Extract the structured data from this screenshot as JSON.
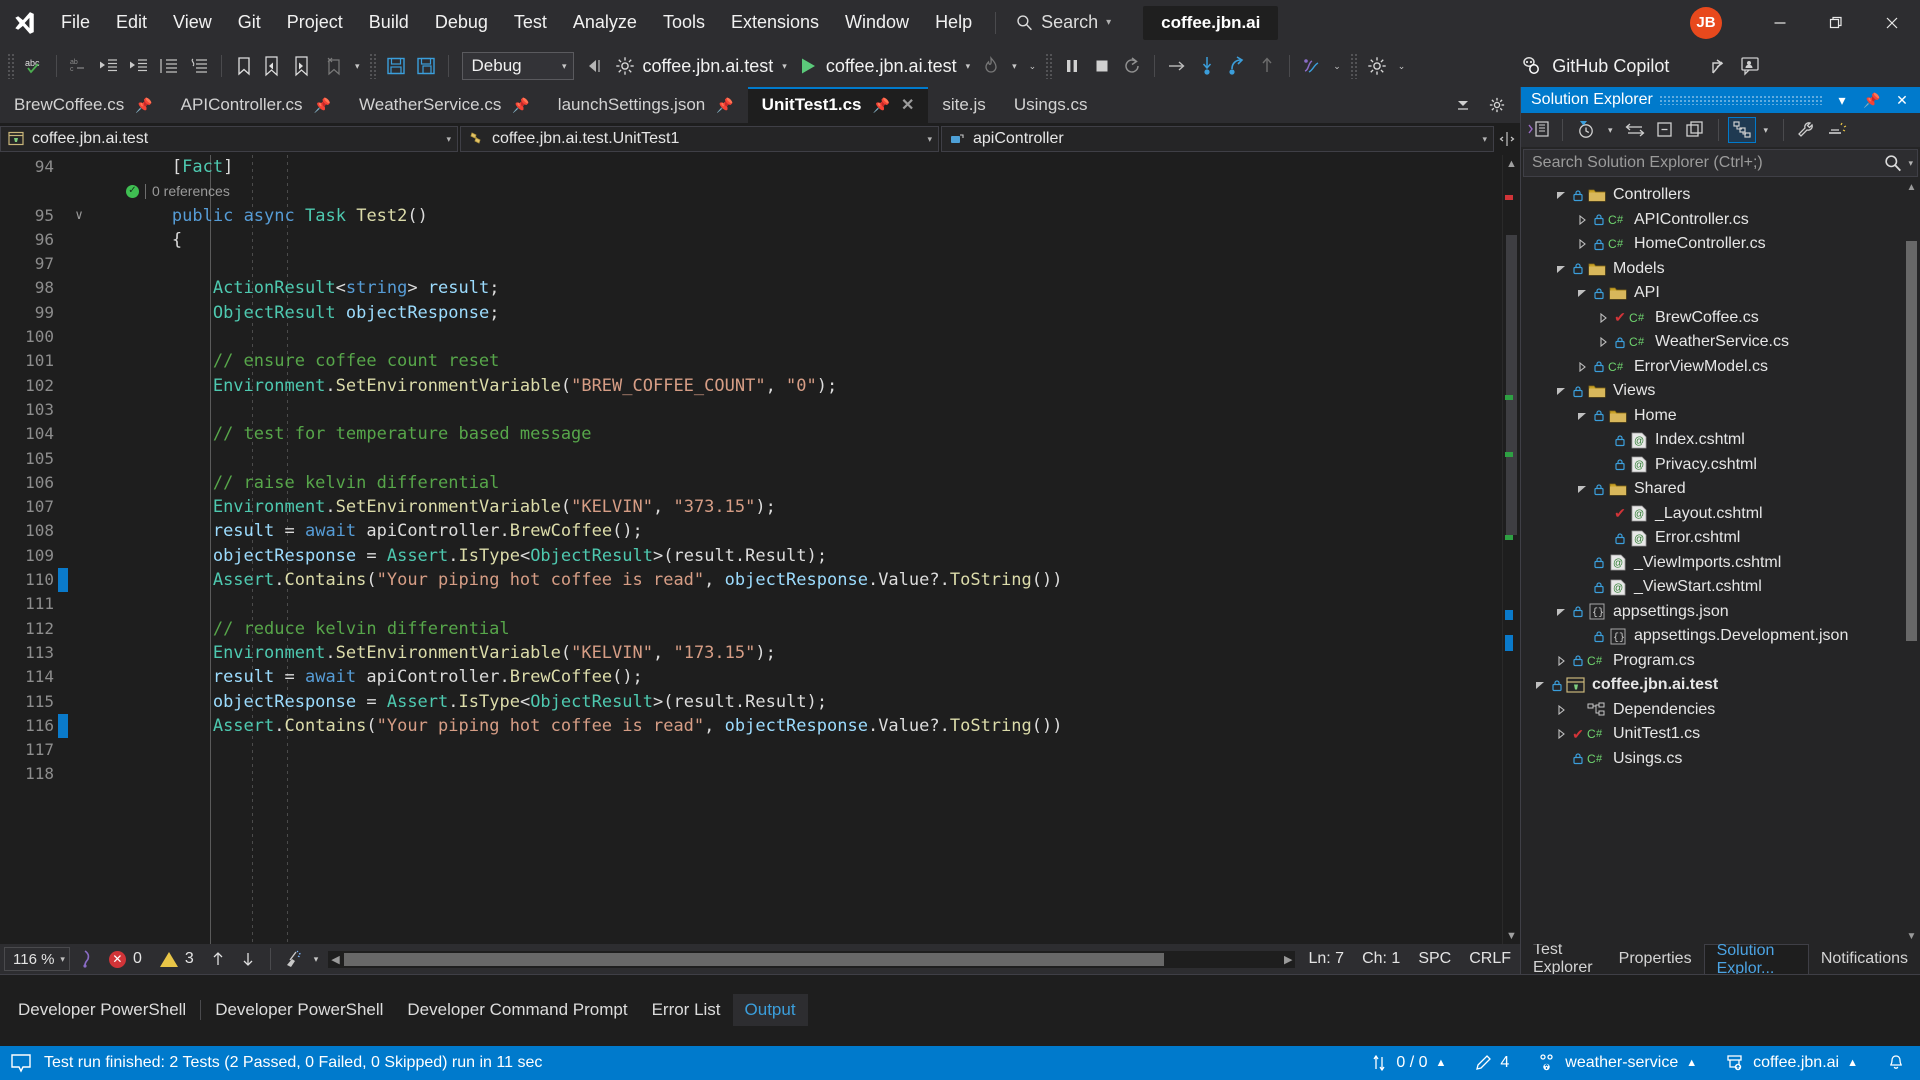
{
  "titlebar": {
    "logo_icon": "visual-studio-logo",
    "menus": [
      "File",
      "Edit",
      "View",
      "Git",
      "Project",
      "Build",
      "Debug",
      "Test",
      "Analyze",
      "Tools",
      "Extensions",
      "Window",
      "Help"
    ],
    "search": {
      "label": "Search",
      "icon": "search-icon",
      "caret": "▾"
    },
    "solution_name": "coffee.jbn.ai",
    "avatar_initials": "JB",
    "avatar_color": "#e8491d",
    "window_buttons": {
      "minimize": "minimize-icon",
      "restore": "restore-icon",
      "close": "close-icon"
    }
  },
  "toolbar": {
    "config_value": "Debug",
    "startup_project": "coffee.jbn.ai.test",
    "run_target": "coffee.jbn.ai.test",
    "copilot_label": "GitHub Copilot",
    "caret": "▾"
  },
  "tabs": [
    {
      "label": "BrewCoffee.cs",
      "pinned": true,
      "active": false
    },
    {
      "label": "APIController.cs",
      "pinned": true,
      "active": false
    },
    {
      "label": "WeatherService.cs",
      "pinned": true,
      "active": false
    },
    {
      "label": "launchSettings.json",
      "pinned": true,
      "active": false
    },
    {
      "label": "UnitTest1.cs",
      "pinned": true,
      "active": true,
      "closable": true
    },
    {
      "label": "site.js",
      "pinned": false,
      "active": false
    },
    {
      "label": "Usings.cs",
      "pinned": false,
      "active": false
    }
  ],
  "navbar": {
    "project": "coffee.jbn.ai.test",
    "type": "coffee.jbn.ai.test.UnitTest1",
    "member": "apiController",
    "caret": "▾"
  },
  "code": {
    "codelens": "0 references",
    "first_line_number": 94,
    "lines": [
      {
        "n": 94,
        "fold": "",
        "change": "",
        "tokens": [
          {
            "t": "        ",
            "c": "pln"
          },
          {
            "t": "[",
            "c": "pln"
          },
          {
            "t": "Fact",
            "c": "attr"
          },
          {
            "t": "]",
            "c": "pln"
          }
        ]
      },
      {
        "n": "",
        "fold": "",
        "change": "",
        "codelens": true
      },
      {
        "n": 95,
        "fold": "∨",
        "change": "",
        "tokens": [
          {
            "t": "        ",
            "c": "pln"
          },
          {
            "t": "public",
            "c": "kw"
          },
          {
            "t": " ",
            "c": "pln"
          },
          {
            "t": "async",
            "c": "kw"
          },
          {
            "t": " ",
            "c": "pln"
          },
          {
            "t": "Task",
            "c": "typ"
          },
          {
            "t": " ",
            "c": "pln"
          },
          {
            "t": "Test2",
            "c": "mth"
          },
          {
            "t": "()",
            "c": "pln"
          }
        ]
      },
      {
        "n": 96,
        "fold": "",
        "change": "",
        "tokens": [
          {
            "t": "        {",
            "c": "pln"
          }
        ]
      },
      {
        "n": 97,
        "fold": "",
        "change": "",
        "tokens": []
      },
      {
        "n": 98,
        "fold": "",
        "change": "",
        "tokens": [
          {
            "t": "            ",
            "c": "pln"
          },
          {
            "t": "ActionResult",
            "c": "typ"
          },
          {
            "t": "<",
            "c": "pln"
          },
          {
            "t": "string",
            "c": "kw"
          },
          {
            "t": "> ",
            "c": "pln"
          },
          {
            "t": "result",
            "c": "var"
          },
          {
            "t": ";",
            "c": "pln"
          }
        ]
      },
      {
        "n": 99,
        "fold": "",
        "change": "",
        "tokens": [
          {
            "t": "            ",
            "c": "pln"
          },
          {
            "t": "ObjectResult",
            "c": "typ"
          },
          {
            "t": " ",
            "c": "pln"
          },
          {
            "t": "objectResponse",
            "c": "var"
          },
          {
            "t": ";",
            "c": "pln"
          }
        ]
      },
      {
        "n": 100,
        "fold": "",
        "change": "",
        "tokens": []
      },
      {
        "n": 101,
        "fold": "",
        "change": "",
        "tokens": [
          {
            "t": "            ",
            "c": "pln"
          },
          {
            "t": "// ensure coffee count reset",
            "c": "com"
          }
        ]
      },
      {
        "n": 102,
        "fold": "",
        "change": "",
        "tokens": [
          {
            "t": "            ",
            "c": "pln"
          },
          {
            "t": "Environment",
            "c": "typ"
          },
          {
            "t": ".",
            "c": "pln"
          },
          {
            "t": "SetEnvironmentVariable",
            "c": "mth"
          },
          {
            "t": "(",
            "c": "pln"
          },
          {
            "t": "\"BREW_COFFEE_COUNT\"",
            "c": "str"
          },
          {
            "t": ", ",
            "c": "pln"
          },
          {
            "t": "\"0\"",
            "c": "str"
          },
          {
            "t": ");",
            "c": "pln"
          }
        ]
      },
      {
        "n": 103,
        "fold": "",
        "change": "",
        "tokens": []
      },
      {
        "n": 104,
        "fold": "",
        "change": "",
        "tokens": [
          {
            "t": "            ",
            "c": "pln"
          },
          {
            "t": "// test for temperature based message",
            "c": "com"
          }
        ]
      },
      {
        "n": 105,
        "fold": "",
        "change": "",
        "tokens": []
      },
      {
        "n": 106,
        "fold": "",
        "change": "",
        "tokens": [
          {
            "t": "            ",
            "c": "pln"
          },
          {
            "t": "// raise kelvin differential",
            "c": "com"
          }
        ]
      },
      {
        "n": 107,
        "fold": "",
        "change": "",
        "tokens": [
          {
            "t": "            ",
            "c": "pln"
          },
          {
            "t": "Environment",
            "c": "typ"
          },
          {
            "t": ".",
            "c": "pln"
          },
          {
            "t": "SetEnvironmentVariable",
            "c": "mth"
          },
          {
            "t": "(",
            "c": "pln"
          },
          {
            "t": "\"KELVIN\"",
            "c": "str"
          },
          {
            "t": ", ",
            "c": "pln"
          },
          {
            "t": "\"373.15\"",
            "c": "str"
          },
          {
            "t": ");",
            "c": "pln"
          }
        ]
      },
      {
        "n": 108,
        "fold": "",
        "change": "",
        "tokens": [
          {
            "t": "            ",
            "c": "pln"
          },
          {
            "t": "result",
            "c": "var"
          },
          {
            "t": " = ",
            "c": "pln"
          },
          {
            "t": "await",
            "c": "kw"
          },
          {
            "t": " ",
            "c": "pln"
          },
          {
            "t": "apiController",
            "c": "pln"
          },
          {
            "t": ".",
            "c": "pln"
          },
          {
            "t": "BrewCoffee",
            "c": "mth"
          },
          {
            "t": "();",
            "c": "pln"
          }
        ]
      },
      {
        "n": 109,
        "fold": "",
        "change": "",
        "tokens": [
          {
            "t": "            ",
            "c": "pln"
          },
          {
            "t": "objectResponse",
            "c": "var"
          },
          {
            "t": " = ",
            "c": "pln"
          },
          {
            "t": "Assert",
            "c": "typ"
          },
          {
            "t": ".",
            "c": "pln"
          },
          {
            "t": "IsType",
            "c": "mth"
          },
          {
            "t": "<",
            "c": "pln"
          },
          {
            "t": "ObjectResult",
            "c": "typ"
          },
          {
            "t": ">(",
            "c": "pln"
          },
          {
            "t": "result",
            "c": "pln"
          },
          {
            "t": ".",
            "c": "pln"
          },
          {
            "t": "Result",
            "c": "pln"
          },
          {
            "t": ");",
            "c": "pln"
          }
        ]
      },
      {
        "n": 110,
        "fold": "",
        "change": "mod",
        "tokens": [
          {
            "t": "            ",
            "c": "pln"
          },
          {
            "t": "Assert",
            "c": "typ"
          },
          {
            "t": ".",
            "c": "pln"
          },
          {
            "t": "Contains",
            "c": "mth"
          },
          {
            "t": "(",
            "c": "pln"
          },
          {
            "t": "\"Your piping hot coffee is read\"",
            "c": "str"
          },
          {
            "t": ", ",
            "c": "pln"
          },
          {
            "t": "objectResponse",
            "c": "var"
          },
          {
            "t": ".",
            "c": "pln"
          },
          {
            "t": "Value",
            "c": "pln"
          },
          {
            "t": "?.",
            "c": "pln"
          },
          {
            "t": "ToString",
            "c": "mth"
          },
          {
            "t": "())",
            "c": "pln"
          }
        ]
      },
      {
        "n": 111,
        "fold": "",
        "change": "",
        "tokens": []
      },
      {
        "n": 112,
        "fold": "",
        "change": "",
        "tokens": [
          {
            "t": "            ",
            "c": "pln"
          },
          {
            "t": "// reduce kelvin differential",
            "c": "com"
          }
        ]
      },
      {
        "n": 113,
        "fold": "",
        "change": "",
        "tokens": [
          {
            "t": "            ",
            "c": "pln"
          },
          {
            "t": "Environment",
            "c": "typ"
          },
          {
            "t": ".",
            "c": "pln"
          },
          {
            "t": "SetEnvironmentVariable",
            "c": "mth"
          },
          {
            "t": "(",
            "c": "pln"
          },
          {
            "t": "\"KELVIN\"",
            "c": "str"
          },
          {
            "t": ", ",
            "c": "pln"
          },
          {
            "t": "\"173.15\"",
            "c": "str"
          },
          {
            "t": ");",
            "c": "pln"
          }
        ]
      },
      {
        "n": 114,
        "fold": "",
        "change": "",
        "tokens": [
          {
            "t": "            ",
            "c": "pln"
          },
          {
            "t": "result",
            "c": "var"
          },
          {
            "t": " = ",
            "c": "pln"
          },
          {
            "t": "await",
            "c": "kw"
          },
          {
            "t": " ",
            "c": "pln"
          },
          {
            "t": "apiController",
            "c": "pln"
          },
          {
            "t": ".",
            "c": "pln"
          },
          {
            "t": "BrewCoffee",
            "c": "mth"
          },
          {
            "t": "();",
            "c": "pln"
          }
        ]
      },
      {
        "n": 115,
        "fold": "",
        "change": "",
        "tokens": [
          {
            "t": "            ",
            "c": "pln"
          },
          {
            "t": "objectResponse",
            "c": "var"
          },
          {
            "t": " = ",
            "c": "pln"
          },
          {
            "t": "Assert",
            "c": "typ"
          },
          {
            "t": ".",
            "c": "pln"
          },
          {
            "t": "IsType",
            "c": "mth"
          },
          {
            "t": "<",
            "c": "pln"
          },
          {
            "t": "ObjectResult",
            "c": "typ"
          },
          {
            "t": ">(",
            "c": "pln"
          },
          {
            "t": "result",
            "c": "pln"
          },
          {
            "t": ".",
            "c": "pln"
          },
          {
            "t": "Result",
            "c": "pln"
          },
          {
            "t": ");",
            "c": "pln"
          }
        ]
      },
      {
        "n": 116,
        "fold": "",
        "change": "mod",
        "tokens": [
          {
            "t": "            ",
            "c": "pln"
          },
          {
            "t": "Assert",
            "c": "typ"
          },
          {
            "t": ".",
            "c": "pln"
          },
          {
            "t": "Contains",
            "c": "mth"
          },
          {
            "t": "(",
            "c": "pln"
          },
          {
            "t": "\"Your piping hot coffee is read\"",
            "c": "str"
          },
          {
            "t": ", ",
            "c": "pln"
          },
          {
            "t": "objectResponse",
            "c": "var"
          },
          {
            "t": ".",
            "c": "pln"
          },
          {
            "t": "Value",
            "c": "pln"
          },
          {
            "t": "?.",
            "c": "pln"
          },
          {
            "t": "ToString",
            "c": "mth"
          },
          {
            "t": "())",
            "c": "pln"
          }
        ]
      },
      {
        "n": 117,
        "fold": "",
        "change": "",
        "tokens": []
      },
      {
        "n": 118,
        "fold": "",
        "change": "",
        "tokens": []
      }
    ]
  },
  "editor_status": {
    "zoom": "116 %",
    "errors": "0",
    "warnings": "3",
    "ln": "Ln: 7",
    "ch": "Ch: 1",
    "spaces": "SPC",
    "eol": "CRLF"
  },
  "solution_explorer": {
    "title": "Solution Explorer",
    "search_placeholder": "Search Solution Explorer (Ctrl+;)",
    "tree": [
      {
        "indent": 1,
        "twisty": "open",
        "lock": true,
        "icon": "folder-icon",
        "label": "Controllers"
      },
      {
        "indent": 2,
        "twisty": "closed",
        "lock": true,
        "icon": "csharp-icon",
        "label": "APIController.cs"
      },
      {
        "indent": 2,
        "twisty": "closed",
        "lock": true,
        "icon": "csharp-icon",
        "label": "HomeController.cs"
      },
      {
        "indent": 1,
        "twisty": "open",
        "lock": true,
        "icon": "folder-icon",
        "label": "Models"
      },
      {
        "indent": 2,
        "twisty": "open",
        "lock": true,
        "icon": "folder-icon",
        "label": "API"
      },
      {
        "indent": 3,
        "twisty": "closed",
        "check": true,
        "icon": "csharp-icon",
        "label": "BrewCoffee.cs"
      },
      {
        "indent": 3,
        "twisty": "closed",
        "lock": true,
        "icon": "csharp-icon",
        "label": "WeatherService.cs"
      },
      {
        "indent": 2,
        "twisty": "closed",
        "lock": true,
        "icon": "csharp-icon",
        "label": "ErrorViewModel.cs"
      },
      {
        "indent": 1,
        "twisty": "open",
        "lock": true,
        "icon": "folder-icon",
        "label": "Views"
      },
      {
        "indent": 2,
        "twisty": "open",
        "lock": true,
        "icon": "folder-icon",
        "label": "Home"
      },
      {
        "indent": 3,
        "twisty": "none",
        "lock": true,
        "icon": "razor-icon",
        "label": "Index.cshtml"
      },
      {
        "indent": 3,
        "twisty": "none",
        "lock": true,
        "icon": "razor-icon",
        "label": "Privacy.cshtml"
      },
      {
        "indent": 2,
        "twisty": "open",
        "lock": true,
        "icon": "folder-icon",
        "label": "Shared"
      },
      {
        "indent": 3,
        "twisty": "none",
        "check": true,
        "icon": "razor-icon",
        "label": "_Layout.cshtml"
      },
      {
        "indent": 3,
        "twisty": "none",
        "lock": true,
        "icon": "razor-icon",
        "label": "Error.cshtml"
      },
      {
        "indent": 2,
        "twisty": "none",
        "lock": true,
        "icon": "razor-icon",
        "label": "_ViewImports.cshtml"
      },
      {
        "indent": 2,
        "twisty": "none",
        "lock": true,
        "icon": "razor-icon",
        "label": "_ViewStart.cshtml"
      },
      {
        "indent": 1,
        "twisty": "open",
        "lock": true,
        "icon": "json-icon",
        "label": "appsettings.json"
      },
      {
        "indent": 2,
        "twisty": "none",
        "lock": true,
        "icon": "json-icon",
        "label": "appsettings.Development.json"
      },
      {
        "indent": 1,
        "twisty": "closed",
        "lock": true,
        "icon": "csharp-icon",
        "label": "Program.cs"
      },
      {
        "indent": 0,
        "twisty": "open",
        "lock": true,
        "icon": "testproj-icon",
        "label": "coffee.jbn.ai.test",
        "bold": true
      },
      {
        "indent": 1,
        "twisty": "closed",
        "lock": false,
        "icon": "deps-icon",
        "label": "Dependencies"
      },
      {
        "indent": 1,
        "twisty": "closed",
        "check": true,
        "icon": "csharp-icon",
        "label": "UnitTest1.cs"
      },
      {
        "indent": 1,
        "twisty": "none",
        "lock": true,
        "icon": "csharp-icon",
        "label": "Usings.cs"
      }
    ],
    "panel_tabs": [
      {
        "label": "Test Explorer",
        "active": false
      },
      {
        "label": "Properties",
        "active": false
      },
      {
        "label": "Solution Explor...",
        "active": true
      },
      {
        "label": "Notifications",
        "active": false
      }
    ]
  },
  "bottom_panel": {
    "tabs": [
      {
        "label": "Developer PowerShell",
        "active": false
      },
      {
        "label": "Developer PowerShell",
        "active": false
      },
      {
        "label": "Developer Command Prompt",
        "active": false
      },
      {
        "label": "Error List",
        "active": false
      },
      {
        "label": "Output",
        "active": true
      }
    ]
  },
  "statusbar": {
    "message": "Test run finished: 2 Tests (2 Passed, 0 Failed, 0 Skipped) run in 11 sec",
    "sync": "0 / 0",
    "sync_caret": "▲",
    "pending_changes": "4",
    "branch": "weather-service",
    "branch_caret": "▲",
    "repo": "coffee.jbn.ai",
    "repo_caret": "▲",
    "bell_icon": "notification-bell-icon",
    "accent": "#007acc"
  }
}
